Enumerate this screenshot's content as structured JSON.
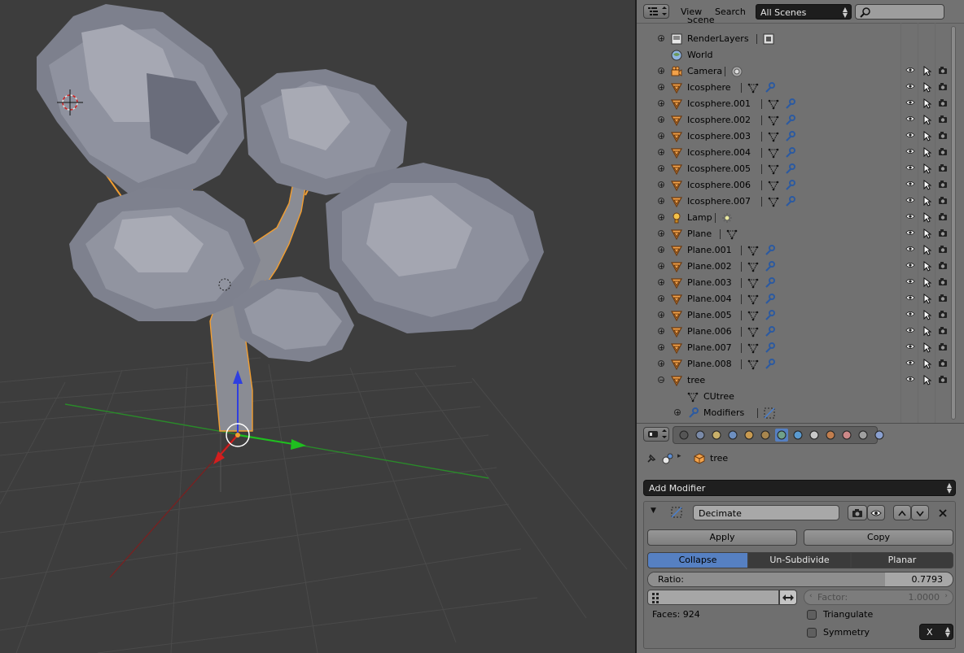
{
  "colors": {
    "viewport_bg": "#3d3d3d",
    "outliner_bg": "#717171",
    "active_blue": "#5680c2",
    "selection_orange": "#f29e31",
    "grid_green": "#1e8f1e",
    "axis_red": "#8c1d1d"
  },
  "outliner": {
    "header": {
      "view_label": "View",
      "search_label": "Search",
      "scene_select": "All Scenes",
      "search_placeholder": ""
    },
    "scene_label": "Scene",
    "rows": [
      {
        "label": "RenderLayers",
        "icon": "render-layers-icon",
        "subs": [
          "render-layer-icon"
        ],
        "restrict": false
      },
      {
        "label": "World",
        "icon": "world-icon",
        "subs": [],
        "restrict": false
      },
      {
        "label": "Camera",
        "icon": "camera-icon",
        "subs": [
          "camera-data-icon"
        ],
        "restrict": true
      },
      {
        "label": "Icosphere",
        "icon": "mesh-icon",
        "subs": [
          "mesh-data-icon",
          "wrench-icon"
        ],
        "restrict": true
      },
      {
        "label": "Icosphere.001",
        "icon": "mesh-icon",
        "subs": [
          "mesh-data-icon",
          "wrench-icon"
        ],
        "restrict": true
      },
      {
        "label": "Icosphere.002",
        "icon": "mesh-icon",
        "subs": [
          "mesh-data-icon",
          "wrench-icon"
        ],
        "restrict": true
      },
      {
        "label": "Icosphere.003",
        "icon": "mesh-icon",
        "subs": [
          "mesh-data-icon",
          "wrench-icon"
        ],
        "restrict": true
      },
      {
        "label": "Icosphere.004",
        "icon": "mesh-icon",
        "subs": [
          "mesh-data-icon",
          "wrench-icon"
        ],
        "restrict": true
      },
      {
        "label": "Icosphere.005",
        "icon": "mesh-icon",
        "subs": [
          "mesh-data-icon",
          "wrench-icon"
        ],
        "restrict": true
      },
      {
        "label": "Icosphere.006",
        "icon": "mesh-icon",
        "subs": [
          "mesh-data-icon",
          "wrench-icon"
        ],
        "restrict": true
      },
      {
        "label": "Icosphere.007",
        "icon": "mesh-icon",
        "subs": [
          "mesh-data-icon",
          "wrench-icon"
        ],
        "restrict": true
      },
      {
        "label": "Lamp",
        "icon": "lamp-icon",
        "subs": [
          "lamp-data-icon"
        ],
        "restrict": true
      },
      {
        "label": "Plane",
        "icon": "mesh-icon",
        "subs": [
          "mesh-data-icon"
        ],
        "restrict": true
      },
      {
        "label": "Plane.001",
        "icon": "mesh-icon",
        "subs": [
          "mesh-data-icon",
          "wrench-icon"
        ],
        "restrict": true
      },
      {
        "label": "Plane.002",
        "icon": "mesh-icon",
        "subs": [
          "mesh-data-icon",
          "wrench-icon"
        ],
        "restrict": true
      },
      {
        "label": "Plane.003",
        "icon": "mesh-icon",
        "subs": [
          "mesh-data-icon",
          "wrench-icon"
        ],
        "restrict": true
      },
      {
        "label": "Plane.004",
        "icon": "mesh-icon",
        "subs": [
          "mesh-data-icon",
          "wrench-icon"
        ],
        "restrict": true
      },
      {
        "label": "Plane.005",
        "icon": "mesh-icon",
        "subs": [
          "mesh-data-icon",
          "wrench-icon"
        ],
        "restrict": true
      },
      {
        "label": "Plane.006",
        "icon": "mesh-icon",
        "subs": [
          "mesh-data-icon",
          "wrench-icon"
        ],
        "restrict": true
      },
      {
        "label": "Plane.007",
        "icon": "mesh-icon",
        "subs": [
          "mesh-data-icon",
          "wrench-icon"
        ],
        "restrict": true
      },
      {
        "label": "Plane.008",
        "icon": "mesh-icon",
        "subs": [
          "mesh-data-icon",
          "wrench-icon"
        ],
        "restrict": true
      },
      {
        "label": "tree",
        "icon": "mesh-icon",
        "subs": [],
        "restrict": true,
        "expanded": true
      },
      {
        "label": "CUtree",
        "icon": "mesh-data-icon",
        "subs": [],
        "restrict": false,
        "child": true
      },
      {
        "label": "Modifiers",
        "icon": "wrench-icon",
        "subs": [
          "decimate-icon"
        ],
        "restrict": false,
        "child": true
      }
    ]
  },
  "properties": {
    "breadcrumb_object": "tree",
    "add_modifier_label": "Add Modifier",
    "modifier": {
      "name": "Decimate",
      "apply_label": "Apply",
      "copy_label": "Copy",
      "modes": [
        "Collapse",
        "Un-Subdivide",
        "Planar"
      ],
      "active_mode": "Collapse",
      "ratio_label": "Ratio:",
      "ratio_value": "0.7793",
      "ratio": 0.7793,
      "factor_label": "Factor:",
      "factor_value": "1.0000",
      "faces_label": "Faces: 924",
      "triangulate_label": "Triangulate",
      "symmetry_label": "Symmetry",
      "symmetry_axis": "X"
    }
  }
}
